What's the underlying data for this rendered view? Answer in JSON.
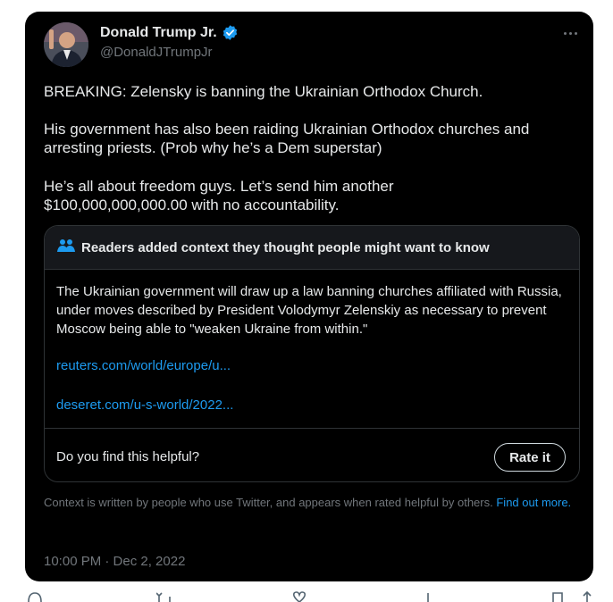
{
  "author": {
    "name": "Donald Trump Jr.",
    "handle": "@DonaldJTrumpJr",
    "verified_color": "#1d9bf0"
  },
  "tweet": {
    "line1": "BREAKING: Zelensky is banning the Ukrainian Orthodox Church.",
    "line2": "His government has also been raiding Ukrainian Orthodox churches and arresting priests. (Prob why he’s a Dem superstar)",
    "line3": "He’s all about freedom guys. Let’s send him another\n$100,000,000,000.00 with no accountability.",
    "timestamp": "10:00 PM · Dec 2, 2022"
  },
  "community_note": {
    "title": "Readers added context they thought people might want to know",
    "body": "The Ukrainian government will draw up a law banning churches affiliated with Russia, under moves described by President Volodymyr Zelenskiy as necessary to prevent Moscow being able to \"weaken Ukraine from within.\"",
    "links": [
      "reuters.com/world/europe/u...",
      "deseret.com/u-s-world/2022..."
    ],
    "helpful_question": "Do you find this helpful?",
    "rate_label": "Rate it",
    "footer": "Context is written by people who use Twitter, and appears when rated helpful by others.",
    "find_out_more": "Find out more."
  },
  "icons": {
    "more": "more-icon",
    "verified": "verified-badge-icon",
    "people": "people-icon",
    "reply": "reply-icon",
    "retweet": "retweet-icon",
    "like": "like-icon",
    "views": "views-icon",
    "bookmark": "bookmark-icon",
    "share": "share-icon"
  },
  "colors": {
    "background": "#000000",
    "text": "#e7e9ea",
    "secondary": "#71767b",
    "accent": "#1d9bf0"
  }
}
